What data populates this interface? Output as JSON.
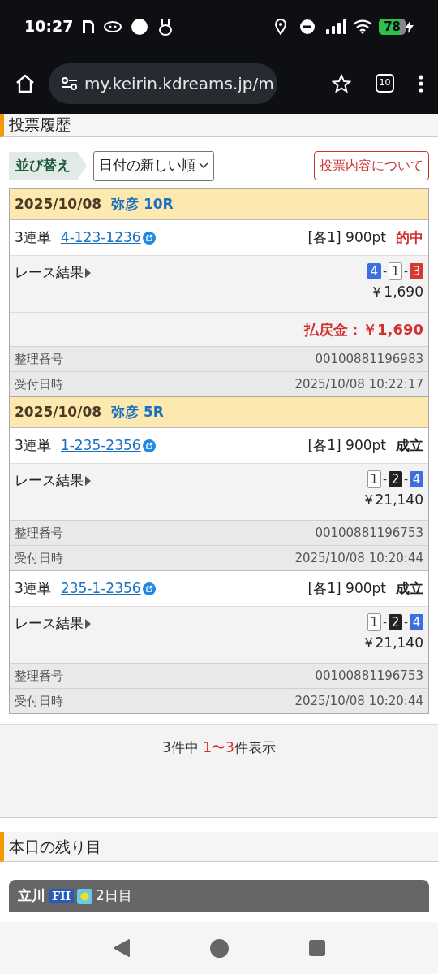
{
  "status_bar": {
    "time": "10:27",
    "battery": "78"
  },
  "browser": {
    "url": "my.keirin.kdreams.jp/m",
    "tab_count": "10"
  },
  "history": {
    "title": "投票履歴",
    "sort_label": "並び替え",
    "sort_select": "日付の新しい順",
    "info_button": "投票内容について",
    "races": [
      {
        "date": "2025/10/08",
        "venue": "弥彦 10R",
        "tickets": [
          {
            "type": "3連単",
            "combo": "4-123-1236",
            "stake": "[各1] 900pt",
            "status": "的中",
            "kind": "hit",
            "result_label": "レース結果",
            "result_separator": "-",
            "result": [
              {
                "text": "4",
                "color": "#3b6fe0"
              },
              {
                "text": "1",
                "color": "#ffffff"
              },
              {
                "text": "3",
                "color": "#d43a2f"
              }
            ],
            "payout": "￥1,690",
            "refund": "払戻金：￥1,690",
            "id_label": "整理番号",
            "id": "00100881196983",
            "time_label": "受付日時",
            "time": "2025/10/08 10:22:17"
          }
        ]
      },
      {
        "date": "2025/10/08",
        "venue": "弥彦 5R",
        "tickets": [
          {
            "type": "3連単",
            "combo": "1-235-2356",
            "stake": "[各1] 900pt",
            "status": "成立",
            "kind": "ok",
            "result_label": "レース結果",
            "result_separator": "-",
            "result": [
              {
                "text": "1",
                "color": "#ffffff"
              },
              {
                "text": "2",
                "color": "#222222"
              },
              {
                "text": "4",
                "color": "#3b6fe0"
              }
            ],
            "payout": "￥21,140",
            "id_label": "整理番号",
            "id": "00100881196753",
            "time_label": "受付日時",
            "time": "2025/10/08 10:20:44"
          },
          {
            "type": "3連単",
            "combo": "235-1-2356",
            "stake": "[各1] 900pt",
            "status": "成立",
            "kind": "ok",
            "result_label": "レース結果",
            "result_separator": "-",
            "result": [
              {
                "text": "1",
                "color": "#ffffff"
              },
              {
                "text": "2",
                "color": "#222222"
              },
              {
                "text": "4",
                "color": "#3b6fe0"
              }
            ],
            "payout": "￥21,140",
            "id_label": "整理番号",
            "id": "00100881196753",
            "time_label": "受付日時",
            "time": "2025/10/08 10:20:44"
          }
        ]
      }
    ],
    "pagination": {
      "prefix": "3件中 ",
      "range": "1〜3",
      "suffix": "件表示"
    }
  },
  "remaining": {
    "title": "本日の残り目",
    "card": {
      "venue": "立川",
      "grade": "FII",
      "day": "2日目"
    }
  }
}
